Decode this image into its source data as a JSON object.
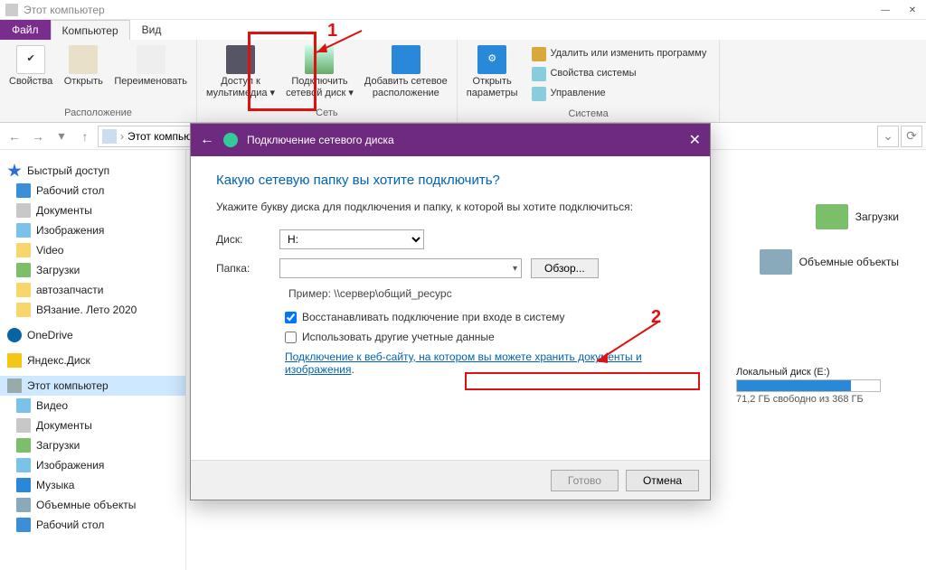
{
  "window": {
    "title": "Этот компьютер"
  },
  "tabs": {
    "file": "Файл",
    "computer": "Компьютер",
    "view": "Вид"
  },
  "ribbon": {
    "group_location": "Расположение",
    "group_network": "Сеть",
    "group_system": "Система",
    "btn_properties": "Свойства",
    "btn_open": "Открыть",
    "btn_rename": "Переименовать",
    "btn_media": "Доступ к\nмультимедиа ▾",
    "btn_map": "Подключить\nсетевой диск ▾",
    "btn_addnet": "Добавить сетевое\nрасположение",
    "btn_settings": "Открыть\nпараметры",
    "btn_uninstall": "Удалить или изменить программу",
    "btn_sysprops": "Свойства системы",
    "btn_manage": "Управление"
  },
  "nav": {
    "breadcrumb": "Этот компьютер"
  },
  "sidebar": {
    "quick": "Быстрый доступ",
    "desktop": "Рабочий стол",
    "documents": "Документы",
    "pictures": "Изображения",
    "video": "Video",
    "downloads": "Загрузки",
    "auto": "автозапчасти",
    "knit": "ВЯзание. Лето 2020",
    "onedrive": "OneDrive",
    "yandex": "Яндекс.Диск",
    "thispc": "Этот компьютер",
    "pc_video": "Видео",
    "pc_docs": "Документы",
    "pc_dl": "Загрузки",
    "pc_pics": "Изображения",
    "pc_music": "Музыка",
    "pc_obj": "Объемные объекты",
    "pc_desktop": "Рабочий стол"
  },
  "folders": {
    "f1": "Загрузки",
    "f2": "Объемные объекты"
  },
  "drive": {
    "label": "Локальный диск (E:)",
    "free": "71,2 ГБ свободно из 368 ГБ"
  },
  "dialog": {
    "title": "Подключение сетевого диска",
    "heading": "Какую сетевую папку вы хотите подключить?",
    "sub": "Укажите букву диска для подключения и папку, к которой вы хотите подключиться:",
    "l_drive": "Диск:",
    "drive_val": "H:",
    "l_folder": "Папка:",
    "browse": "Обзор...",
    "example": "Пример: \\\\сервер\\общий_ресурс",
    "chk_reconnect": "Восстанавливать подключение при входе в систему",
    "chk_creds": "Использовать другие учетные данные",
    "link": "Подключение к веб-сайту, на котором вы можете хранить документы и изображения",
    "btn_done": "Готово",
    "btn_cancel": "Отмена"
  },
  "anno": {
    "n1": "1",
    "n2": "2"
  }
}
